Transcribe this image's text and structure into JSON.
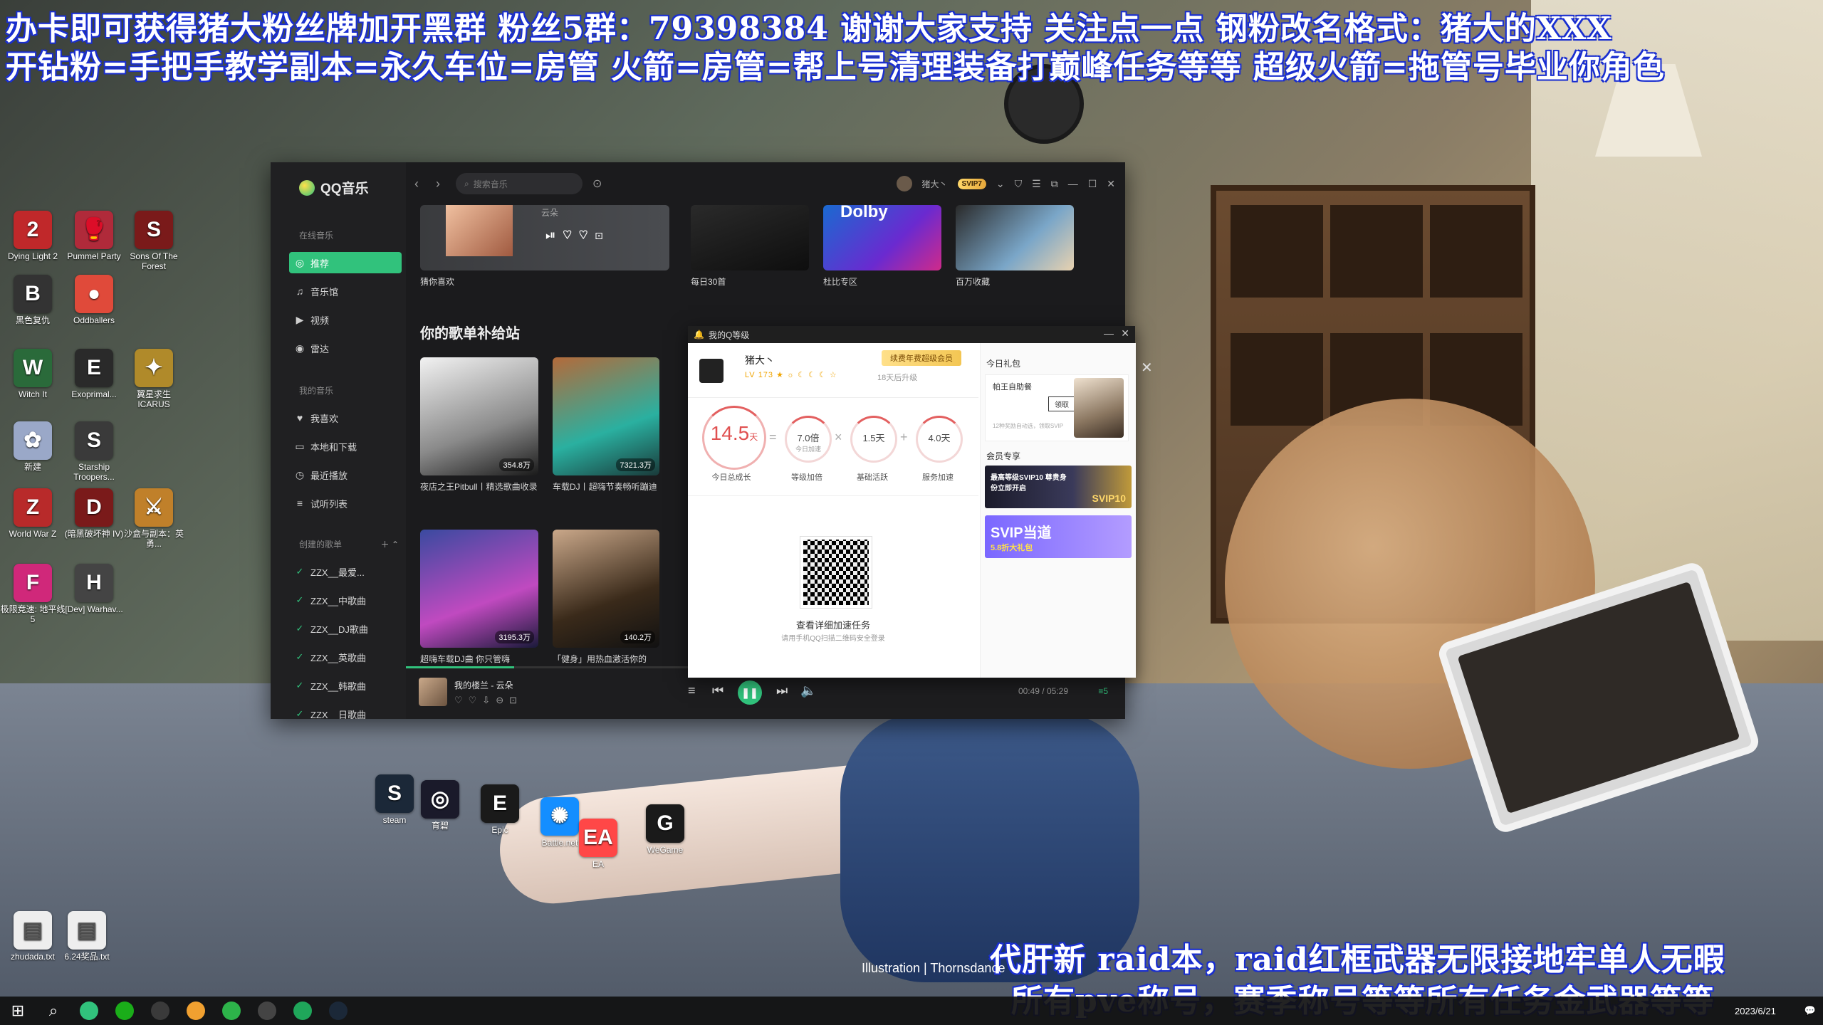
{
  "banners": {
    "line1": "办卡即可获得猪大粉丝牌加开黑群   粉丝5群：79398384 谢谢大家支持 关注点一点 钢粉改名格式：猪大的XXX",
    "line2": "开钻粉=手把手教学副本=永久车位=房管  火箭=房管=帮上号清理装备打巅峰任务等等  超级火箭=拖管号毕业你角色",
    "line3": "代肝新 raid本，raid红框武器无限接地牢单人无暇",
    "line4": "所有pve称号，赛季称号等等所有任务金武器等等"
  },
  "caption": "Illustration | Thornsdance",
  "desktop_icons": [
    {
      "label": "Dying Light 2",
      "glyph": "2",
      "color": "#c0282a"
    },
    {
      "label": "Pummel Party",
      "glyph": "🥊",
      "color": "#b02a3a"
    },
    {
      "label": "Sons Of The Forest",
      "glyph": "S",
      "color": "#7a1a1a"
    },
    {
      "label": "黑色复仇",
      "glyph": "B",
      "color": "#333333"
    },
    {
      "label": "Oddballers",
      "glyph": "●",
      "color": "#e04a3a"
    },
    {
      "label": "Witch It",
      "glyph": "W",
      "color": "#2a6a3a"
    },
    {
      "label": "Exoprimal...",
      "glyph": "E",
      "color": "#2a2a2a"
    },
    {
      "label": "翼星求生 ICARUS",
      "glyph": "✦",
      "color": "#b08a2a"
    },
    {
      "label": "新建",
      "glyph": "✿",
      "color": "#9aa8c8"
    },
    {
      "label": "Starship Troopers...",
      "glyph": "S",
      "color": "#3a3a3a"
    },
    {
      "label": "World War Z",
      "glyph": "Z",
      "color": "#b82a2a"
    },
    {
      "label": "(暗黑破坏神 IV)",
      "glyph": "D",
      "color": "#7a1a1a"
    },
    {
      "label": "沙盒与副本：英勇...",
      "glyph": "⚔",
      "color": "#c0802a"
    },
    {
      "label": "极限竞速: 地平线 5",
      "glyph": "F",
      "color": "#d0287a"
    },
    {
      "label": "[Dev] Warhav...",
      "glyph": "H",
      "color": "#444444"
    },
    {
      "label": "steam",
      "glyph": "S",
      "color": "#1b2838"
    },
    {
      "label": "育碧",
      "glyph": "◎",
      "color": "#1a1a2a"
    },
    {
      "label": "Epic",
      "glyph": "E",
      "color": "#1a1a1a"
    },
    {
      "label": "Battle.net",
      "glyph": "✺",
      "color": "#148eff"
    },
    {
      "label": "EA",
      "glyph": "EA",
      "color": "#ff4747"
    },
    {
      "label": "WeGame",
      "glyph": "G",
      "color": "#1a1a1a"
    },
    {
      "label": "zhudada.txt",
      "glyph": "▤",
      "color": "#eeeeee"
    },
    {
      "label": "6.24奖品.txt",
      "glyph": "▤",
      "color": "#eeeeee"
    }
  ],
  "taskbar": {
    "start": "⊞",
    "search": "⌕",
    "apps": [
      "#31c27c",
      "#1aad19",
      "#3a3a3a",
      "#f0a030",
      "#2db34a",
      "#444444",
      "#1fa65a",
      "#1b2838"
    ],
    "date": "2023/6/21",
    "notify": "💬"
  },
  "qq": {
    "app_name": "QQ音乐",
    "search_placeholder": "搜索音乐",
    "user_name": "猪大丶",
    "vip_badge": "SVIP7",
    "sections": {
      "online": "在线音乐",
      "mine": "我的音乐",
      "created": "创建的歌单"
    },
    "nav_online": [
      {
        "icon": "◎",
        "label": "推荐"
      },
      {
        "icon": "♫",
        "label": "音乐馆"
      },
      {
        "icon": "▶",
        "label": "视频"
      },
      {
        "icon": "◉",
        "label": "雷达"
      }
    ],
    "nav_mine": [
      {
        "icon": "♥",
        "label": "我喜欢"
      },
      {
        "icon": "▭",
        "label": "本地和下载"
      },
      {
        "icon": "◷",
        "label": "最近播放"
      },
      {
        "icon": "≡",
        "label": "试听列表"
      }
    ],
    "playlists": [
      "ZZX__最爱...",
      "ZZX__中歌曲",
      "ZZX__DJ歌曲",
      "ZZX__英歌曲",
      "ZZX__韩歌曲",
      "ZZX__日歌曲"
    ],
    "top_cards": [
      {
        "caption": "猜你喜欢",
        "overlay": "云朵"
      },
      {
        "caption": "每日30首",
        "overlay": ""
      },
      {
        "caption": "杜比专区",
        "overlay": "Dolby"
      },
      {
        "caption": "百万收藏",
        "overlay": ""
      }
    ],
    "section_title": "你的歌单补给站",
    "playlist_cards": [
      {
        "caption": "夜店之王Pitbull丨精选歌曲收录",
        "count": "354.8万"
      },
      {
        "caption": "车载DJ丨超嗨节奏畅听蹦迪",
        "count": "7321.3万"
      },
      {
        "caption": "超嗨车载DJ曲 你只管嗨",
        "count": "3195.3万"
      },
      {
        "caption": "「健身」用热血激活你的",
        "count": "140.2万"
      }
    ],
    "now_playing": {
      "title": "我的楼兰 - 云朵",
      "time": "00:49 / 05:29",
      "quality": "≡5",
      "progress_pct": 15
    }
  },
  "popup": {
    "title": "我的Q等级",
    "user": "猪大丶",
    "badges": "LV 173 ★ ☼ ☾ ☾ ☾ ☆",
    "upgrade_in": "18天后升级",
    "renew_button": "续费年费超级会员",
    "today_total": "14.5",
    "today_unit": "天",
    "today_label": "今日总成长",
    "level_boost_val": "7.0倍",
    "level_boost_sub": "今日加速",
    "level_boost_label": "等级加倍",
    "base_val": "1.5天",
    "base_label": "基础活跃",
    "service_val": "4.0天",
    "service_label": "服务加速",
    "qr_title": "查看详细加速任务",
    "qr_sub": "请用手机QQ扫描二维码安全登录",
    "gift_head": "今日礼包",
    "gift_name": "帕王自助餐",
    "gift_claim": "领取",
    "gift_note": "12种奖励自动选，领取SVIP",
    "vip_head": "会员专享",
    "promo1": "最高等级SVIP10 尊贵身份立即开启",
    "promo1_tag": "SVIP10",
    "promo2": "SVIP当道",
    "promo2_sub": "5.8折大礼包"
  }
}
